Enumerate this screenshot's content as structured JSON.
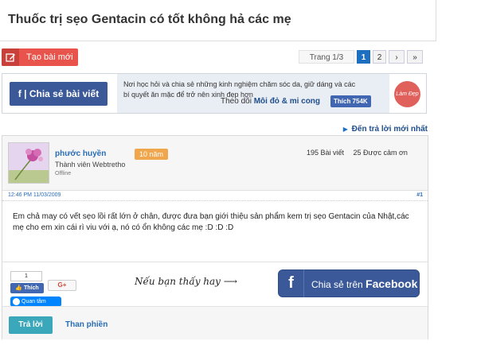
{
  "thread": {
    "title": "Thuốc trị sẹo Gentacin có tốt không hả các mẹ"
  },
  "toolbar": {
    "new_post_label": "Tạo bài mới"
  },
  "pagination": {
    "info": "Trang 1/3",
    "pages": [
      "1",
      "2"
    ],
    "current": "1",
    "next": "›",
    "last": "»"
  },
  "share_banner": {
    "share_label": "f | Chia sẻ bài viết",
    "message": "Nơi học hỏi và chia sẻ những kinh nghiệm chăm sóc da, giữ dáng và các bí quyết ăn mặc để trở nên xinh đẹp hơn",
    "follow_prefix": "Theo dõi",
    "follow_page": "Môi đỏ & mi cong",
    "like_label": "Thích 754K",
    "logo_text": "Làm Đẹp"
  },
  "goto_last": "Đến trả lời mới nhất",
  "post": {
    "author": "phước huyền",
    "badge": "10 năm",
    "role": "Thành viên Webtretho",
    "status": "Offline",
    "posts_count": "195 Bài viết",
    "thanks_count": "25 Được cảm ơn",
    "timestamp": "12:46 PM 11/03/2009",
    "number": "#1",
    "content": "Em chả may có vết sẹo lồi rất lớn ở chân, được đưa bạn giới thiệu sản phẩm kem trị sẹo Gentacin của Nhật,các mẹ cho em xin cái rì viu với ạ, nó có ổn không các mẹ :D :D :D"
  },
  "post_footer": {
    "like_count": "1",
    "like_label": "Thích",
    "gplus_label": "G+",
    "follow_label": "Quan tâm",
    "hint": "Nếu bạn thấy hay",
    "fb_share_prefix": "Chia sẻ trên",
    "fb_share_brand": "Facebook"
  },
  "actions": {
    "reply": "Trả lời",
    "report": "Than phiền"
  },
  "colors": {
    "accent_blue": "#1e6fbf",
    "facebook": "#3b5998",
    "new_post_red": "#e8534b",
    "reply_teal": "#3aa7ba",
    "badge_orange": "#f0a64c"
  }
}
